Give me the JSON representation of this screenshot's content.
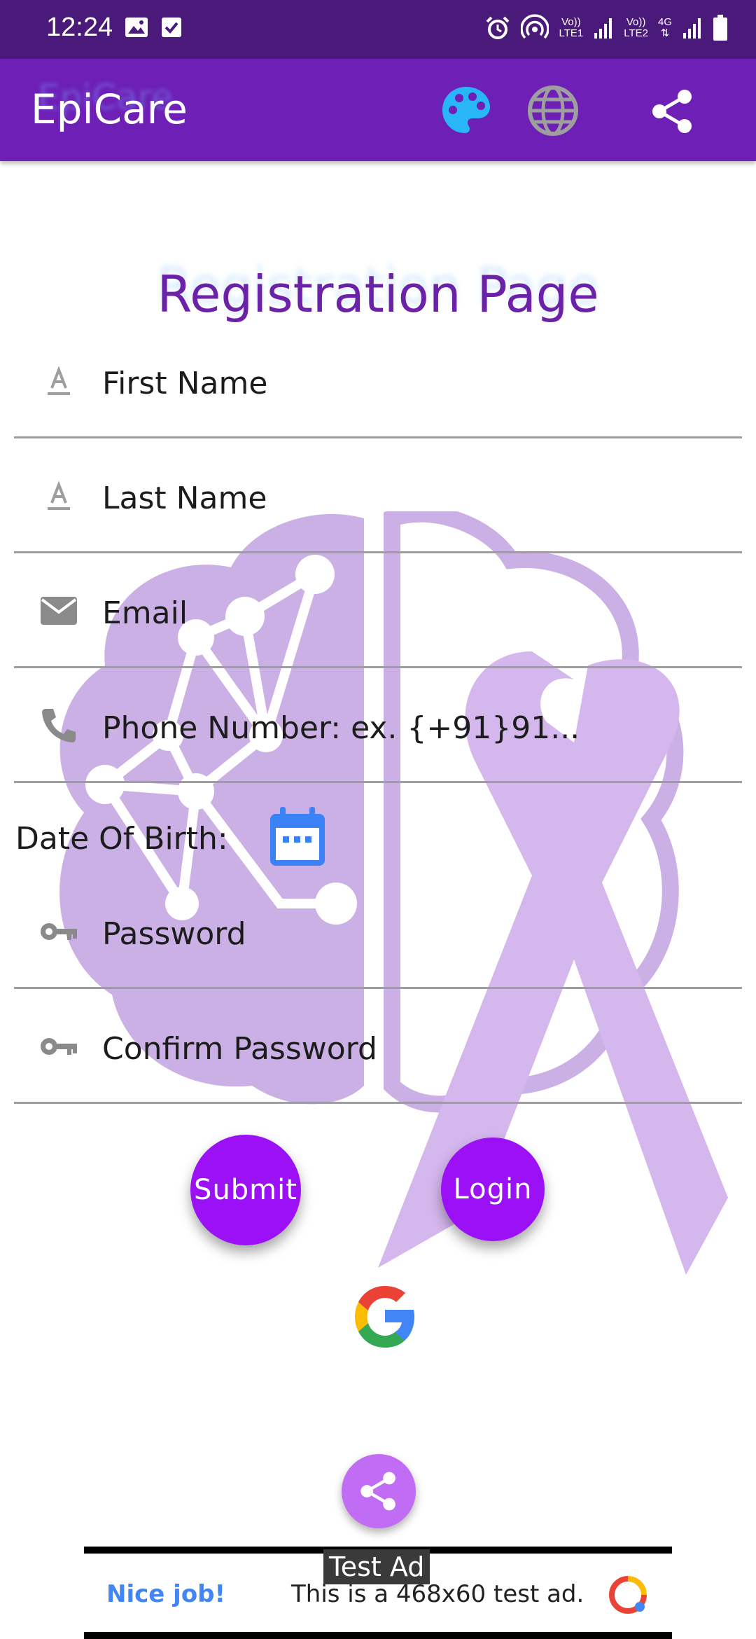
{
  "status_bar": {
    "time": "12:24",
    "sim1": [
      "Vo))",
      "LTE1"
    ],
    "sim2": [
      "Vo))",
      "LTE2"
    ],
    "network": "4G"
  },
  "app_bar": {
    "title": "EpiCare",
    "shadow_title": "EpiCare",
    "icons": [
      "palette-icon",
      "globe-icon",
      "share-icon"
    ],
    "palette_color": "#29b6f6",
    "background": "#6d1fb6"
  },
  "page": {
    "title": "Registration Page",
    "title_color": "#6b22a8"
  },
  "form": {
    "first_name": "First Name",
    "last_name": "Last Name",
    "email": "Email",
    "phone": "Phone Number: ex. {+91}91...",
    "dob_label": "Date Of Birth:",
    "password": "Password",
    "confirm_password": "Confirm Password"
  },
  "buttons": {
    "submit": "Submit",
    "login": "Login",
    "accent": "#9b10f5"
  },
  "ad": {
    "tag": "Test Ad",
    "nice": "Nice job!",
    "text": "This is a 468x60 test ad."
  }
}
